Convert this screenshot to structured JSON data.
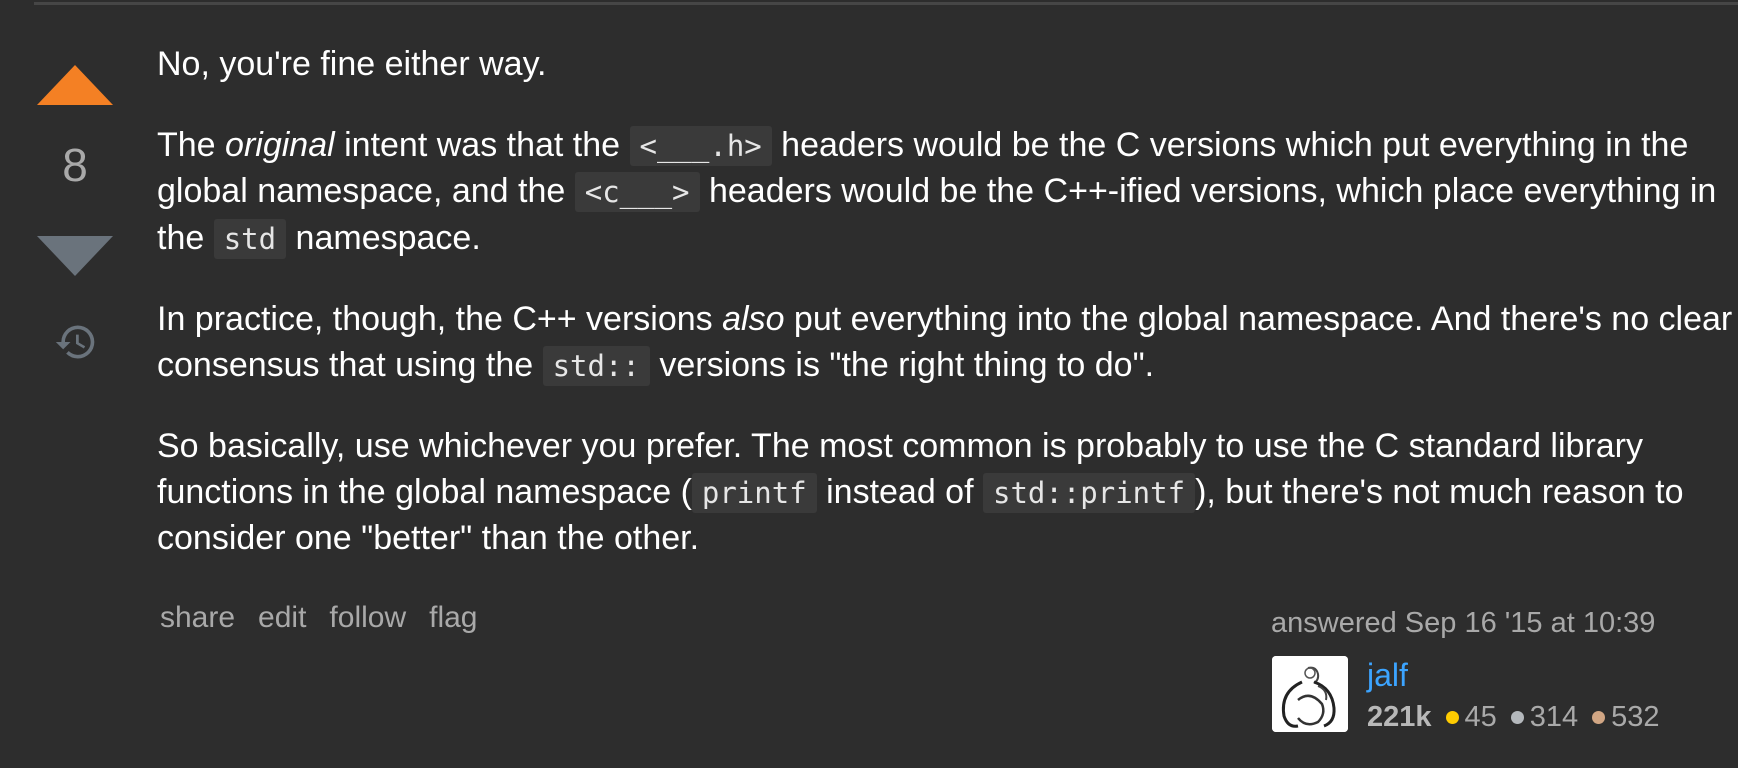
{
  "answer": {
    "score": "8",
    "paragraphs": {
      "p1": "No, you're fine either way.",
      "p2": {
        "t1": "The ",
        "em1": "original",
        "t2": " intent was that the ",
        "code1": "<___.h>",
        "t3": " headers would be the C versions which put everything in the global namespace, and the ",
        "code2": "<c___>",
        "t4": " headers would be the C++-ified versions, which place everything in the ",
        "code3": "std",
        "t5": " namespace."
      },
      "p3": {
        "t1": "In practice, though, the C++ versions ",
        "em1": "also",
        "t2": " put everything into the global namespace. And there's no clear consensus that using the ",
        "code1": "std::",
        "t3": " versions is \"the right thing to do\"."
      },
      "p4": {
        "t1": "So basically, use whichever you prefer. The most common is probably to use the C standard library functions in the global namespace (",
        "code1": "printf",
        "t2": " instead of ",
        "code2": "std::printf",
        "t3": "), but there's not much reason to consider one \"better\" than the other."
      }
    },
    "menu": {
      "share": "share",
      "edit": "edit",
      "follow": "follow",
      "flag": "flag"
    },
    "user": {
      "answered_label": "answered Sep 16 '15 at 10:39",
      "name": "jalf",
      "reputation": "221k",
      "gold": "45",
      "silver": "314",
      "bronze": "532"
    }
  },
  "icons": {
    "upvote": "upvote-arrow-icon",
    "downvote": "downvote-arrow-icon",
    "history": "history-icon"
  },
  "colors": {
    "background": "#2d2d2d",
    "upvote_active": "#f48024",
    "downvote": "#6a737c",
    "link": "#3ca4ff",
    "gold": "#ffcc01",
    "silver": "#b4b8bc",
    "bronze": "#d1a684"
  }
}
